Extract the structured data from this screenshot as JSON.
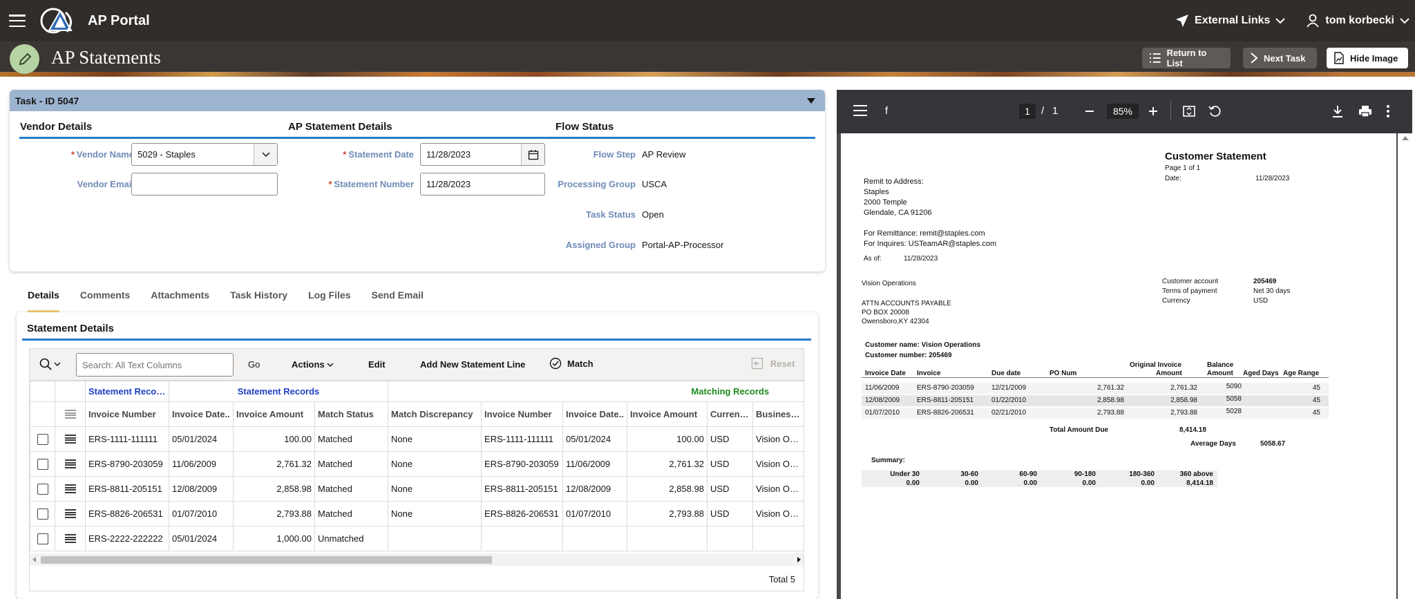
{
  "app": {
    "title": "AP Portal",
    "external_links": "External Links",
    "user": "tom korbecki"
  },
  "header": {
    "page_title": "AP Statements",
    "return_label": "Return to List",
    "next_label": "Next Task",
    "hide_label": "Hide Image"
  },
  "task": {
    "title": "Task - ID 5047",
    "vendor_section": "Vendor Details",
    "statement_section": "AP Statement Details",
    "flow_section": "Flow Status",
    "vendor_name_label": "Vendor Name",
    "vendor_name": "5029 - Staples",
    "vendor_email_label": "Vendor Email",
    "vendor_email": "",
    "statement_date_label": "Statement Date",
    "statement_date": "11/28/2023",
    "statement_number_label": "Statement Number",
    "statement_number": "11/28/2023",
    "flow_step_label": "Flow Step",
    "flow_step": "AP Review",
    "processing_group_label": "Processing Group",
    "processing_group": "USCA",
    "task_status_label": "Task Status",
    "task_status": "Open",
    "assigned_group_label": "Assigned Group",
    "assigned_group": "Portal-AP-Processor"
  },
  "tabs": [
    "Details",
    "Comments",
    "Attachments",
    "Task History",
    "Log Files",
    "Send Email"
  ],
  "statement": {
    "title": "Statement Details",
    "search_placeholder": "Search: All Text Columns",
    "go": "Go",
    "actions": "Actions",
    "edit": "Edit",
    "add_line": "Add New Statement Line",
    "match": "Match",
    "reset": "Reset",
    "group_statement_1": "Statement Records",
    "group_statement_2": "Statement Records",
    "group_matching": "Matching Records",
    "columns": [
      "Invoice Number",
      "Invoice Date..",
      "Invoice Amount",
      "Match Status",
      "Match Discrepancy",
      "Invoice Number",
      "Invoice Date..",
      "Invoice Amount",
      "Currency",
      "Business U"
    ],
    "rows": [
      [
        "ERS-1111-111111",
        "05/01/2024",
        "100.00",
        "Matched",
        "None",
        "ERS-1111-111111",
        "05/01/2024",
        "100.00",
        "USD",
        "Vision Opera"
      ],
      [
        "ERS-8790-203059",
        "11/06/2009",
        "2,761.32",
        "Matched",
        "None",
        "ERS-8790-203059",
        "11/06/2009",
        "2,761.32",
        "USD",
        "Vision Opera"
      ],
      [
        "ERS-8811-205151",
        "12/08/2009",
        "2,858.98",
        "Matched",
        "None",
        "ERS-8811-205151",
        "12/08/2009",
        "2,858.98",
        "USD",
        "Vision Opera"
      ],
      [
        "ERS-8826-206531",
        "01/07/2010",
        "2,793.88",
        "Matched",
        "None",
        "ERS-8826-206531",
        "01/07/2010",
        "2,793.88",
        "USD",
        "Vision Opera"
      ],
      [
        "ERS-2222-222222",
        "05/01/2024",
        "1,000.00",
        "Unmatched",
        "",
        "",
        "",
        "",
        "",
        ""
      ]
    ],
    "total": "Total 5"
  },
  "viewer": {
    "file": "f",
    "page": "1",
    "pages": "1",
    "zoom": "85%"
  },
  "doc": {
    "title": "Customer Statement",
    "page": "Page 1 of 1",
    "date_label": "Date:",
    "date": "11/28/2023",
    "remit_label": "Remit to Address:",
    "remit_lines": [
      "Staples",
      "2000 Temple",
      "Glendale, CA 91206"
    ],
    "for_remittance": "For Remittance:  remit@staples.com",
    "for_inquires": "For Inquires:  USTeamAR@staples.com",
    "as_of_label": "As of:",
    "as_of": "11/28/2023",
    "vision": "Vision Operations",
    "attn_lines": [
      "ATTN ACCOUNTS PAYABLE",
      "PO BOX 20008",
      "Owensboro,KY 42304"
    ],
    "acct_labels": [
      "Customer account",
      "Terms of payment",
      "Currency"
    ],
    "acct_values": [
      "205469",
      "Net 30 days",
      "USD"
    ],
    "cust_name": "Customer name: Vision Operations",
    "cust_num": "Customer number: 205469",
    "inv_headers": [
      "Invoice Date",
      "Invoice",
      "Due date",
      "PO Num",
      "Original Invoice",
      "Amount",
      "Balance",
      "Amount",
      "Aged Days",
      "Age Range"
    ],
    "inv_rows": [
      [
        "11/06/2009",
        "ERS-8790-203059",
        "12/21/2009",
        "2,761.32",
        "2,761.32",
        "5090",
        "45"
      ],
      [
        "12/08/2009",
        "ERS-8811-205151",
        "01/22/2010",
        "2,858.98",
        "2,858.98",
        "5058",
        "45"
      ],
      [
        "01/07/2010",
        "ERS-8826-206531",
        "02/21/2010",
        "2,793.88",
        "2,793.88",
        "5028",
        "45"
      ]
    ],
    "total_label": "Total Amount Due",
    "total": "8,414.18",
    "avg_label": "Average Days",
    "avg": "5058.67",
    "summary_label": "Summary:",
    "summary_headers": [
      "Under 30",
      "30-60",
      "60-90",
      "90-180",
      "180-360",
      "360 above"
    ],
    "summary_values": [
      "0.00",
      "0.00",
      "0.00",
      "0.00",
      "0.00",
      "8,414.18"
    ]
  }
}
